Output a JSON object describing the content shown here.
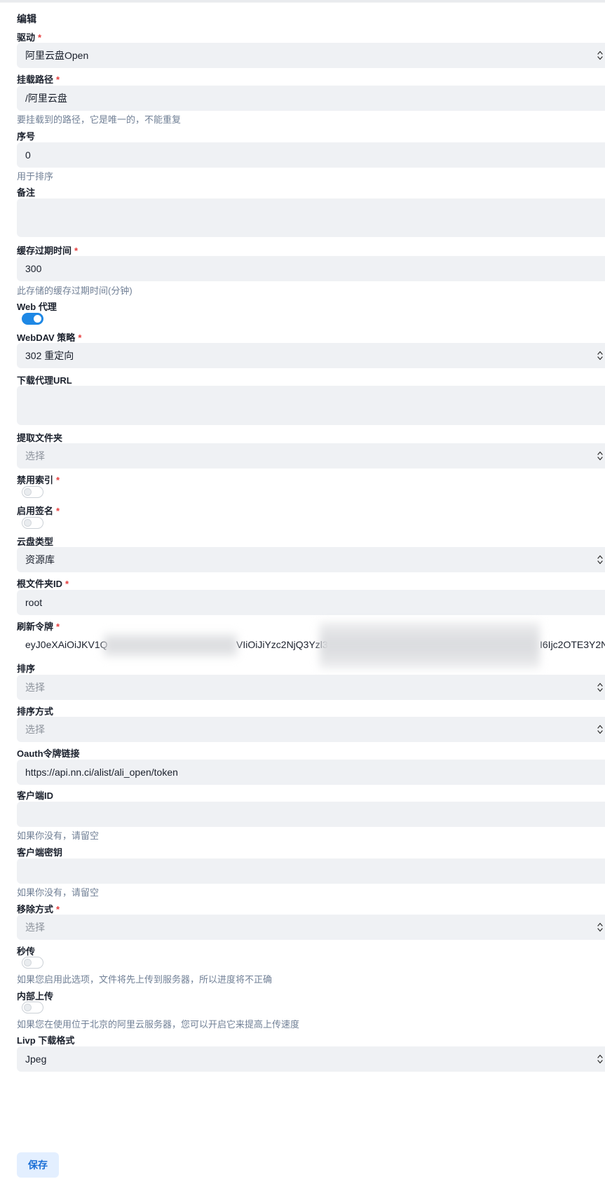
{
  "page": {
    "title": "编辑"
  },
  "form": {
    "driver": {
      "label": "驱动",
      "value": "阿里云盘Open"
    },
    "mount_path": {
      "label": "挂载路径",
      "value": "/阿里云盘",
      "hint": "要挂载到的路径，它是唯一的，不能重复"
    },
    "order": {
      "label": "序号",
      "value": "0",
      "hint": "用于排序"
    },
    "remark": {
      "label": "备注",
      "value": ""
    },
    "cache_expiration": {
      "label": "缓存过期时间",
      "value": "300",
      "hint": "此存储的缓存过期时间(分钟)"
    },
    "web_proxy": {
      "label": "Web 代理",
      "enabled": true
    },
    "webdav_policy": {
      "label": "WebDAV 策略",
      "value": "302 重定向"
    },
    "download_proxy_url": {
      "label": "下载代理URL",
      "value": ""
    },
    "extract_folder": {
      "label": "提取文件夹",
      "placeholder": "选择"
    },
    "disable_index": {
      "label": "禁用索引",
      "enabled": false
    },
    "enable_sign": {
      "label": "启用签名",
      "enabled": false
    },
    "drive_type": {
      "label": "云盘类型",
      "value": "资源库"
    },
    "root_folder_id": {
      "label": "根文件夹ID",
      "value": "root"
    },
    "refresh_token": {
      "label": "刷新令牌",
      "part1": "eyJ0eXAiOiJKV1Q",
      "part2": "VIiOiJiYzc2NjQ3Yzl3",
      "part3": "I6Ijc2OTE3Y2N"
    },
    "order_by": {
      "label": "排序",
      "placeholder": "选择"
    },
    "order_direction": {
      "label": "排序方式",
      "placeholder": "选择"
    },
    "oauth_token_url": {
      "label": "Oauth令牌链接",
      "value": "https://api.nn.ci/alist/ali_open/token"
    },
    "client_id": {
      "label": "客户端ID",
      "value": "",
      "hint": "如果你没有，请留空"
    },
    "client_secret": {
      "label": "客户端密钥",
      "value": "",
      "hint": "如果你没有，请留空"
    },
    "remove_way": {
      "label": "移除方式",
      "placeholder": "选择"
    },
    "rapid_upload": {
      "label": "秒传",
      "enabled": false,
      "hint": "如果您启用此选项，文件将先上传到服务器，所以进度将不正确"
    },
    "internal_upload": {
      "label": "内部上传",
      "enabled": false,
      "hint": "如果您在使用位于北京的阿里云服务器，您可以开启它来提高上传速度"
    },
    "livp_format": {
      "label": "Livp 下载格式",
      "value": "Jpeg"
    }
  },
  "actions": {
    "save_label": "保存"
  },
  "colors": {
    "accent": "#1e88e5",
    "required": "#e53e3e",
    "field_bg": "#eff1f4",
    "button_bg": "#e3efff"
  }
}
